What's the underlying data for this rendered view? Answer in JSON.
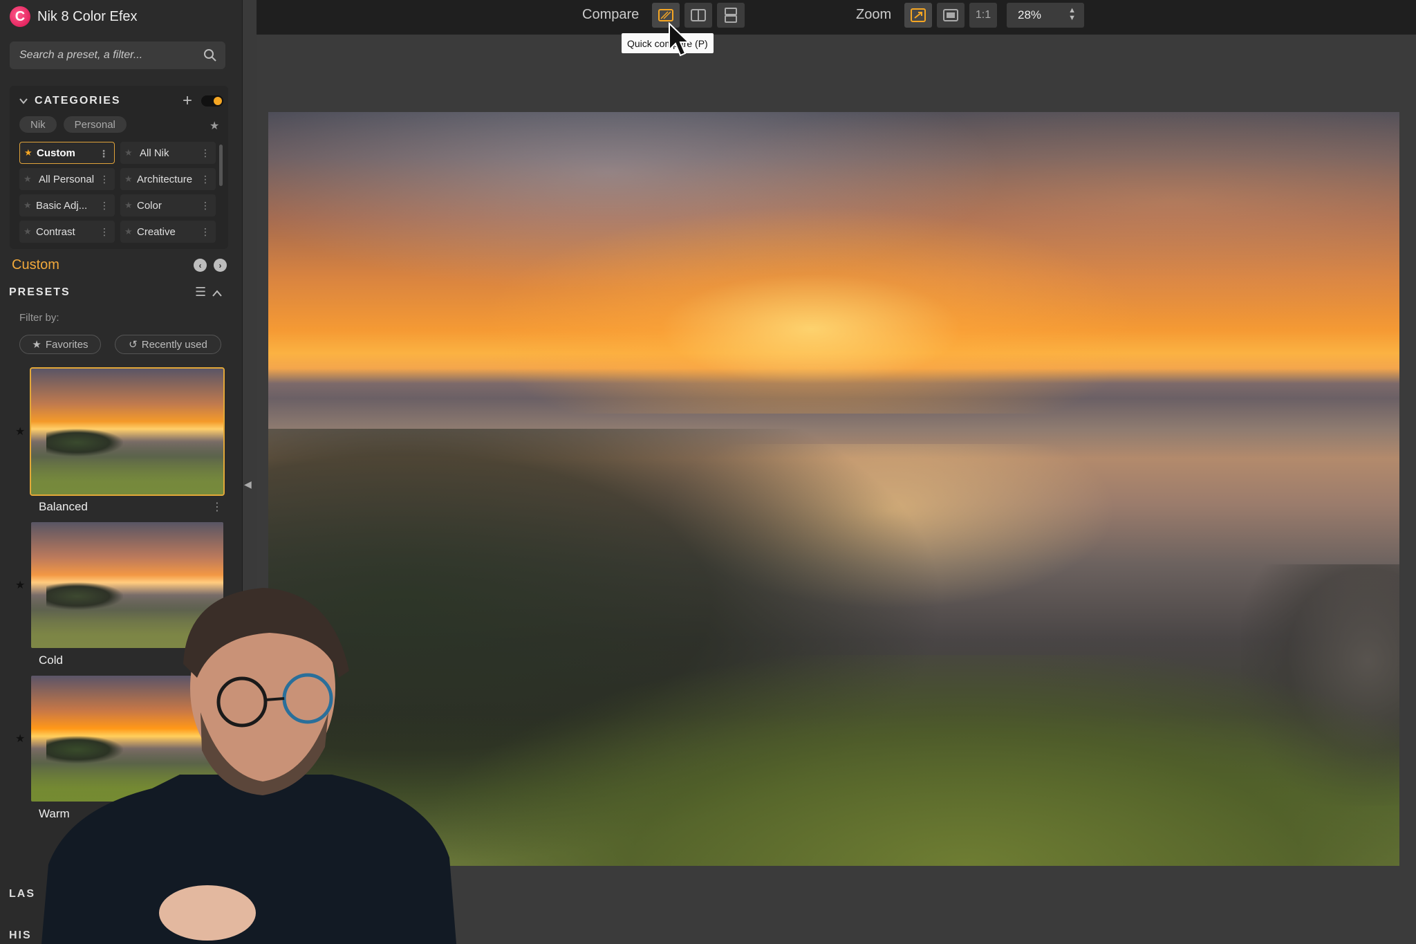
{
  "app": {
    "title": "Nik 8 Color Efex",
    "logo_letter": "C"
  },
  "search": {
    "placeholder": "Search a preset, a filter..."
  },
  "categories": {
    "title": "CATEGORIES",
    "add_symbol": "+",
    "chips": [
      "Nik",
      "Personal"
    ],
    "items": [
      {
        "label": "Custom",
        "active": true
      },
      {
        "label": "All Nik",
        "active": false
      },
      {
        "label": "All Personal",
        "active": false
      },
      {
        "label": "Architecture",
        "active": false
      },
      {
        "label": "Basic Adj...",
        "active": false
      },
      {
        "label": "Color",
        "active": false
      },
      {
        "label": "Contrast",
        "active": false
      },
      {
        "label": "Creative",
        "active": false
      }
    ]
  },
  "collection": {
    "label": "Custom"
  },
  "presets": {
    "title": "PRESETS",
    "filter_by": "Filter by:",
    "filters": [
      "Favorites",
      "Recently used"
    ],
    "items": [
      {
        "label": "Balanced",
        "selected": true
      },
      {
        "label": "Cold",
        "selected": false
      },
      {
        "label": "Warm",
        "selected": false
      }
    ]
  },
  "bottom_sections": {
    "layers": "LAS",
    "history": "HIS"
  },
  "toolbar": {
    "compare_label": "Compare",
    "zoom_label": "Zoom",
    "one_to_one": "1:1",
    "zoom_value": "28%",
    "tooltip": "Quick compare (P)"
  },
  "colors": {
    "accent": "#f5a623",
    "brand": "#e0144f",
    "panel": "#2b2b2b",
    "canvas": "#3b3b3b"
  }
}
